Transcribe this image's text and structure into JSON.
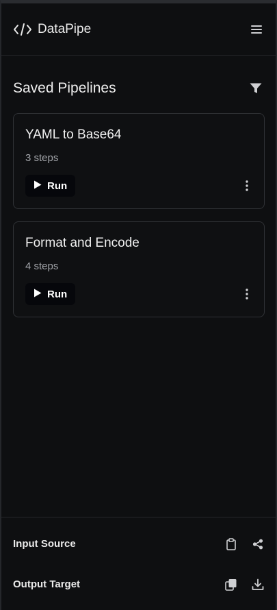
{
  "app": {
    "name": "DataPipe",
    "logo_icon": "code-icon",
    "menu_icon": "hamburger-icon"
  },
  "section": {
    "title": "Saved Pipelines",
    "filter_icon": "filter-icon"
  },
  "pipelines": [
    {
      "title": "YAML to Base64",
      "steps": "3 steps",
      "run_label": "Run"
    },
    {
      "title": "Format and Encode",
      "steps": "4 steps",
      "run_label": "Run"
    }
  ],
  "bottom": {
    "input": {
      "label": "Input Source",
      "icons": [
        "clipboard-icon",
        "share-icon"
      ]
    },
    "output": {
      "label": "Output Target",
      "icons": [
        "copy-icon",
        "download-icon"
      ]
    }
  },
  "colors": {
    "background": "#0e0f11",
    "border": "#303236",
    "muted_text": "#a3a5aa",
    "run_button": "#06070b"
  }
}
